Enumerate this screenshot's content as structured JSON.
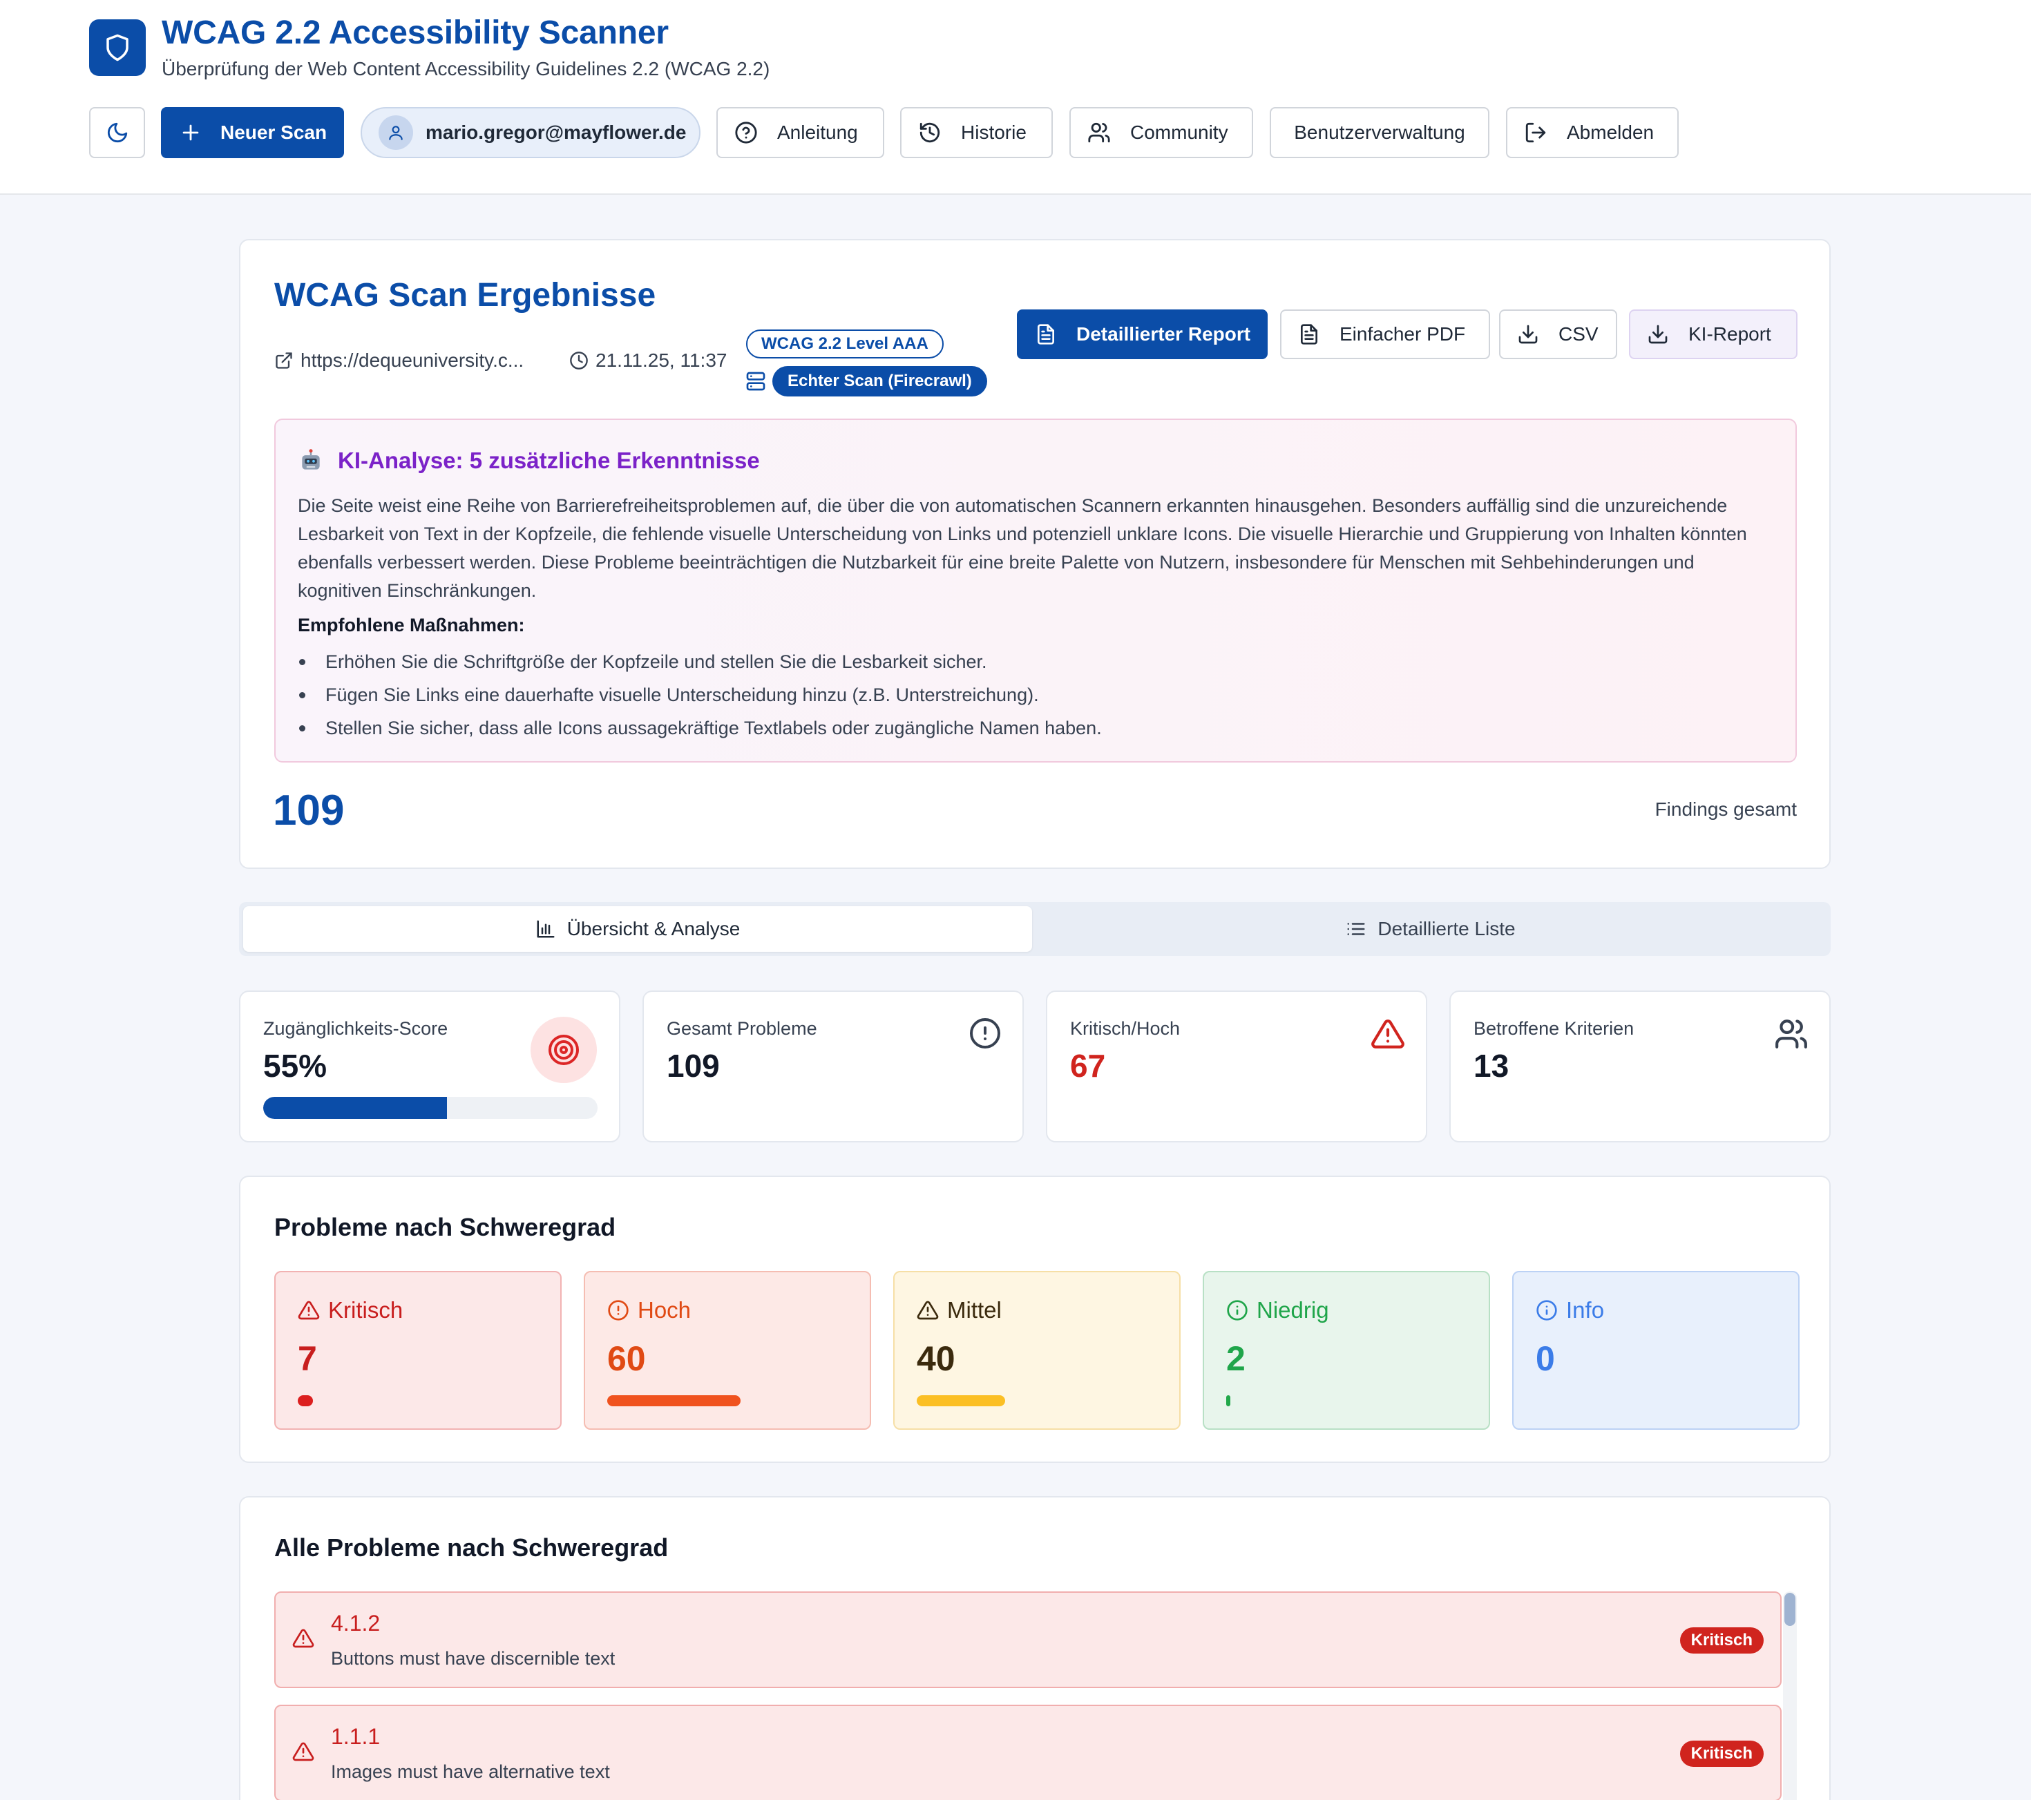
{
  "header": {
    "title": "WCAG 2.2 Accessibility Scanner",
    "subtitle": "Überprüfung der Web Content Accessibility Guidelines 2.2 (WCAG 2.2)",
    "new_scan_label": "Neuer Scan",
    "user_email": "mario.gregor@mayflower.de",
    "help_label": "Anleitung",
    "history_label": "Historie",
    "community_label": "Community",
    "admin_label": "Benutzerverwaltung",
    "logout_label": "Abmelden"
  },
  "results": {
    "title": "WCAG Scan Ergebnisse",
    "url": "https://dequeuniversity.c...",
    "timestamp": "21.11.25, 11:37",
    "level_badge": "WCAG 2.2 Level AAA",
    "scan_badge": "Echter Scan (Firecrawl)",
    "buttons": {
      "detailed_report": "Detaillierter Report",
      "simple_pdf": "Einfacher PDF",
      "csv": "CSV",
      "ai_report": "KI-Report"
    },
    "ai": {
      "title": "KI-Analyse: 5 zusätzliche Erkenntnisse",
      "text": "Die Seite weist eine Reihe von Barrierefreiheitsproblemen auf, die über die von automatischen Scannern erkannten hinausgehen. Besonders auffällig sind die unzureichende Lesbarkeit von Text in der Kopfzeile, die fehlende visuelle Unterscheidung von Links und potenziell unklare Icons. Die visuelle Hierarchie und Gruppierung von Inhalten könnten ebenfalls verbessert werden. Diese Probleme beeinträchtigen die Nutzbarkeit für eine breite Palette von Nutzern, insbesondere für Menschen mit Sehbehinderungen und kognitiven Einschränkungen.",
      "recommendations_title": "Empfohlene Maßnahmen:",
      "recommendations": [
        "Erhöhen Sie die Schriftgröße der Kopfzeile und stellen Sie die Lesbarkeit sicher.",
        "Fügen Sie Links eine dauerhafte visuelle Unterscheidung hinzu (z.B. Unterstreichung).",
        "Stellen Sie sicher, dass alle Icons aussagekräftige Textlabels oder zugängliche Namen haben."
      ]
    },
    "total_findings": "109",
    "total_label": "Findings gesamt"
  },
  "tabs": {
    "overview": "Übersicht & Analyse",
    "list": "Detaillierte Liste"
  },
  "stats": {
    "score_label": "Zugänglichkeits-Score",
    "score_value": "55%",
    "score_fraction": 0.55,
    "total_label": "Gesamt Probleme",
    "total_value": "109",
    "critical_label": "Kritisch/Hoch",
    "critical_value": "67",
    "affected_label": "Betroffene Kriterien",
    "affected_value": "13"
  },
  "severity": {
    "title": "Probleme nach Schweregrad",
    "max": 109,
    "items": [
      {
        "label": "Kritisch",
        "count": "7",
        "value": 7
      },
      {
        "label": "Hoch",
        "count": "60",
        "value": 60
      },
      {
        "label": "Mittel",
        "count": "40",
        "value": 40
      },
      {
        "label": "Niedrig",
        "count": "2",
        "value": 2
      },
      {
        "label": "Info",
        "count": "0",
        "value": 0
      }
    ]
  },
  "all_problems": {
    "title": "Alle Probleme nach Schweregrad",
    "items": [
      {
        "code": "4.1.2",
        "description": "Buttons must have discernible text",
        "badge": "Kritisch"
      },
      {
        "code": "1.1.1",
        "description": "Images must have alternative text",
        "badge": "Kritisch"
      }
    ]
  },
  "colors": {
    "brand": "#0b4da8",
    "critical": "#dc1f1f",
    "high": "#f0521e",
    "medium": "#fbbf24",
    "low": "#22a84a",
    "info": "#3b7ce8"
  },
  "icons": {
    "logo": "shield-icon",
    "theme": "moon-icon",
    "new_scan": "plus-icon",
    "user": "user-icon",
    "help": "help-circle-icon",
    "history": "history-icon",
    "community": "users-icon",
    "logout": "logout-icon",
    "url": "external-link-icon",
    "time": "clock-icon",
    "scan_type": "server-icon",
    "report": "file-text-icon",
    "download": "download-icon",
    "ai": "robot-icon",
    "overview_tab": "bar-chart-icon",
    "list_tab": "list-icon",
    "score": "target-icon",
    "total": "alert-circle-icon",
    "critical": "alert-triangle-icon",
    "affected": "users-icon"
  }
}
